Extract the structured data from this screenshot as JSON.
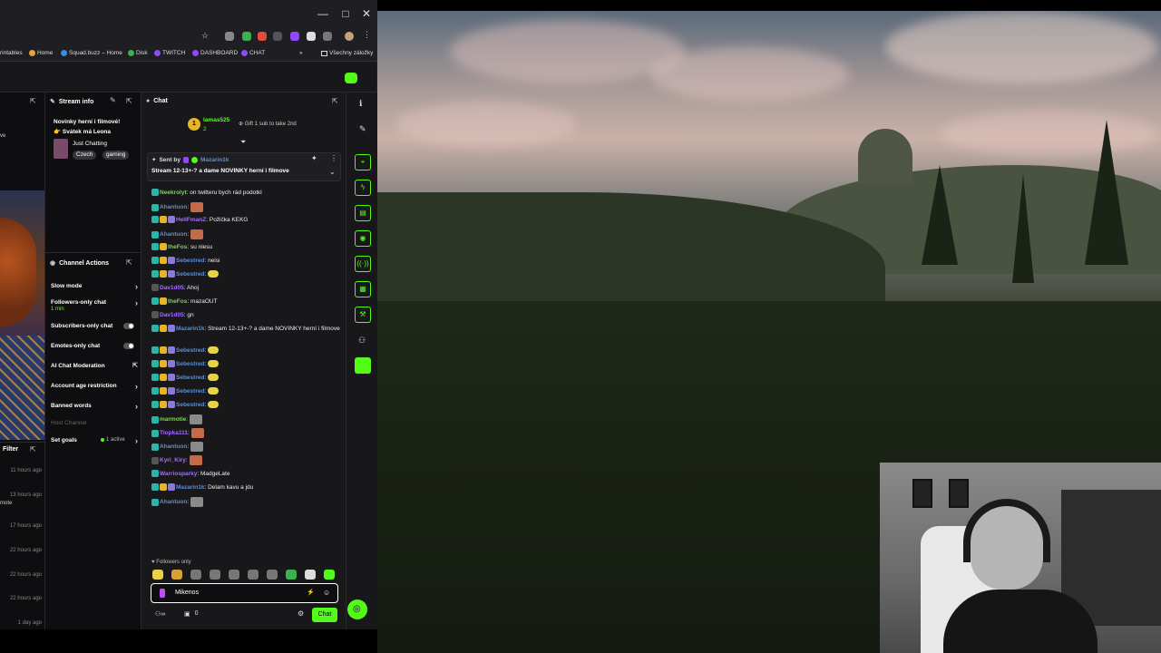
{
  "browser": {
    "window_controls": {
      "minimize": "—",
      "maximize": "□",
      "close": "✕"
    },
    "bookmarks": [
      {
        "label": "rintables",
        "color": "#e34b3b"
      },
      {
        "label": "Home",
        "color": "#e3a43b"
      },
      {
        "label": "Squad.buzz – Home",
        "color": "#3b8be3"
      },
      {
        "label": "Disk",
        "color": "#3bb24f"
      },
      {
        "label": "TWITCH",
        "color": "#9146ff"
      },
      {
        "label": "DASHBOARD",
        "color": "#9146ff"
      },
      {
        "label": "CHAT",
        "color": "#9146ff"
      }
    ],
    "more_bookmarks": "»",
    "all_bookmarks": "Všechny záložky"
  },
  "stream_info": {
    "title": "Stream info",
    "stream_title_line1": "Novinky herní i filmové!",
    "stream_title_line2": "👉 Svátek má Leona",
    "category": "Just Chatting",
    "tags": [
      "Czech",
      "gaming"
    ]
  },
  "channel_actions": {
    "title": "Channel Actions",
    "items": [
      {
        "label": "Slow mode",
        "kind": "chevron"
      },
      {
        "label": "Followers-only chat",
        "sub": "1 min",
        "kind": "chevron"
      },
      {
        "label": "Subscribers-only chat",
        "kind": "toggle"
      },
      {
        "label": "Emotes-only chat",
        "kind": "toggle"
      },
      {
        "label": "AI Chat Moderation",
        "kind": "external"
      },
      {
        "label": "Account age restriction",
        "kind": "chevron"
      },
      {
        "label": "Banned words",
        "kind": "chevron"
      },
      {
        "label": "Host Channel",
        "kind": "disabled"
      },
      {
        "label": "Set goals",
        "sub": "1 active",
        "kind": "chevron"
      }
    ]
  },
  "filter": {
    "title": "Filter",
    "times": [
      "11 hours ago",
      "13 hours ago",
      "17 hours ago",
      "22 hours ago",
      "22 hours ago",
      "22 hours ago",
      "1 day ago"
    ],
    "cut_labels": [
      "ve",
      "mote"
    ]
  },
  "chat": {
    "title": "Chat",
    "top_gifter": {
      "rank": "1",
      "name": "lamas525",
      "count": "2",
      "gift_text": "Gift 1 sub to take 2nd"
    },
    "pinned": {
      "sent_by": "Sent by",
      "user": "Mazarin1k",
      "text": "Stream 12-13+-? a dame NOVINKY herní i filmove"
    },
    "messages": [
      {
        "user": "Neekrolyt",
        "color": "#7fd35c",
        "text": "on twitteru bych rád podotkl",
        "badges": 1
      },
      {
        "user": "Ahantuon",
        "color": "#5c8fd3",
        "text": "",
        "avatar": true,
        "badges": 1
      },
      {
        "user": "HellFmanZ",
        "color": "#a36bff",
        "text": "Požička KEKG",
        "badges": 3
      },
      {
        "user": "Ahantuon",
        "color": "#5c8fd3",
        "text": "",
        "avatar": true,
        "badges": 1
      },
      {
        "user": "theFos",
        "color": "#7fd35c",
        "text": "su niesu",
        "badges": 2
      },
      {
        "user": "Sebestred",
        "color": "#5c8fd3",
        "text": "neisi",
        "badges": 3
      },
      {
        "user": "Sebestred",
        "color": "#5c8fd3",
        "text": "",
        "emote": true,
        "badges": 3
      },
      {
        "user": "Dav1d05",
        "color": "#a36bff",
        "text": "Ahoj",
        "badges": 0
      },
      {
        "user": "theFos",
        "color": "#7fd35c",
        "text": "mazaOUT",
        "badges": 2
      },
      {
        "user": "Dav1d05",
        "color": "#a36bff",
        "text": "gn",
        "badges": 0
      },
      {
        "user": "Mazarin1k",
        "color": "#5c8fd3",
        "text": "Stream 12-13+-? a dame NOVINKY herní i filmove",
        "badges": 3
      },
      {
        "user": "Sebestred",
        "color": "#5c8fd3",
        "text": "",
        "emote": true,
        "badges": 3
      },
      {
        "user": "Sebestred",
        "color": "#5c8fd3",
        "text": "",
        "emote": true,
        "badges": 3
      },
      {
        "user": "Sebestred",
        "color": "#5c8fd3",
        "text": "",
        "emote": true,
        "badges": 3
      },
      {
        "user": "Sebestred",
        "color": "#5c8fd3",
        "text": "",
        "emote": true,
        "badges": 3
      },
      {
        "user": "Sebestred",
        "color": "#5c8fd3",
        "text": "",
        "emote": true,
        "badges": 3
      },
      {
        "user": "marmotie",
        "color": "#7fd35c",
        "text": "",
        "avatar": true,
        "badges": 1
      },
      {
        "user": "Tiopka111",
        "color": "#a36bff",
        "text": "",
        "avatar": true,
        "badges": 1
      },
      {
        "user": "Ahantuon",
        "color": "#5c8fd3",
        "text": "",
        "avatar": true,
        "badges": 1
      },
      {
        "user": "Kyri_Kiry",
        "color": "#a36bff",
        "text": "",
        "avatar": true,
        "badges": 0
      },
      {
        "user": "Warriosparky",
        "color": "#a36bff",
        "text": "MadgeLate",
        "badges": 1
      },
      {
        "user": "Mazarin1k",
        "color": "#5c8fd3",
        "text": "Delam kavu a jdu",
        "badges": 3
      },
      {
        "user": "Ahantuon",
        "color": "#5c8fd3",
        "text": "",
        "avatar": true,
        "badges": 1
      }
    ],
    "followers_only": "Followers only",
    "input_value": "Mikenos",
    "viewer_count": "0",
    "chat_button": "Chat"
  },
  "colors": {
    "accent": "#53fc18",
    "bg": "#18181b",
    "bg_dark": "#0e0e10"
  },
  "side_icons": [
    "info-icon",
    "pencil-icon",
    "camera-icon",
    "bolt-icon",
    "doc-icon",
    "chat-bubble-icon",
    "broadcast-icon",
    "server-icon",
    "wrench-icon",
    "users-icon",
    "grid-icon"
  ]
}
